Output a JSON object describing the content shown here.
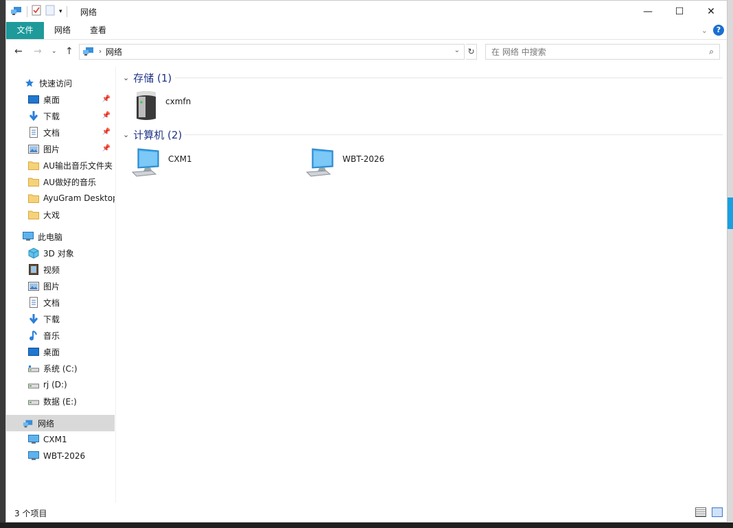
{
  "window": {
    "title": "网络"
  },
  "caption": {
    "minimize": "—",
    "maximize": "☐",
    "close": "✕"
  },
  "ribbon": {
    "tabs": [
      {
        "label": "文件"
      },
      {
        "label": "网络"
      },
      {
        "label": "查看"
      }
    ],
    "help": "?"
  },
  "address": {
    "path": "网络",
    "search_placeholder": "在 网络 中搜索"
  },
  "nav": {
    "quick_access": "快速访问",
    "quick_items": [
      {
        "label": "桌面",
        "icon": "desktop-icon"
      },
      {
        "label": "下载",
        "icon": "download-icon"
      },
      {
        "label": "文档",
        "icon": "document-icon"
      },
      {
        "label": "图片",
        "icon": "picture-icon"
      },
      {
        "label": "AU输出音乐文件夹",
        "icon": "folder-icon"
      },
      {
        "label": "AU做好的音乐",
        "icon": "folder-icon"
      },
      {
        "label": "AyuGram Desktop",
        "icon": "folder-icon"
      },
      {
        "label": "大戏",
        "icon": "folder-icon"
      }
    ],
    "this_pc": "此电脑",
    "pc_items": [
      {
        "label": "3D 对象",
        "icon": "3d-objects-icon"
      },
      {
        "label": "视频",
        "icon": "video-icon"
      },
      {
        "label": "图片",
        "icon": "picture-icon"
      },
      {
        "label": "文档",
        "icon": "document-icon"
      },
      {
        "label": "下载",
        "icon": "download-icon"
      },
      {
        "label": "音乐",
        "icon": "music-icon"
      },
      {
        "label": "桌面",
        "icon": "desktop-icon"
      },
      {
        "label": "系统 (C:)",
        "icon": "drive-icon"
      },
      {
        "label": "rj (D:)",
        "icon": "drive-icon"
      },
      {
        "label": "数据 (E:)",
        "icon": "drive-icon"
      }
    ],
    "network": "网络",
    "network_items": [
      {
        "label": "CXM1",
        "icon": "computer-icon"
      },
      {
        "label": "WBT-2026",
        "icon": "computer-icon"
      }
    ]
  },
  "content": {
    "groups": [
      {
        "header": "存储 (1)",
        "items": [
          {
            "label": "cxmfn",
            "icon": "nas-storage-icon"
          }
        ]
      },
      {
        "header": "计算机 (2)",
        "items": [
          {
            "label": "CXM1",
            "icon": "network-computer-icon"
          },
          {
            "label": "WBT-2026",
            "icon": "network-computer-icon"
          }
        ]
      }
    ]
  },
  "status": {
    "count": "3 个项目"
  },
  "colors": {
    "file_tab": "#1e9a9a",
    "group_header": "#1e3287",
    "selection": "#d9d9d9"
  }
}
